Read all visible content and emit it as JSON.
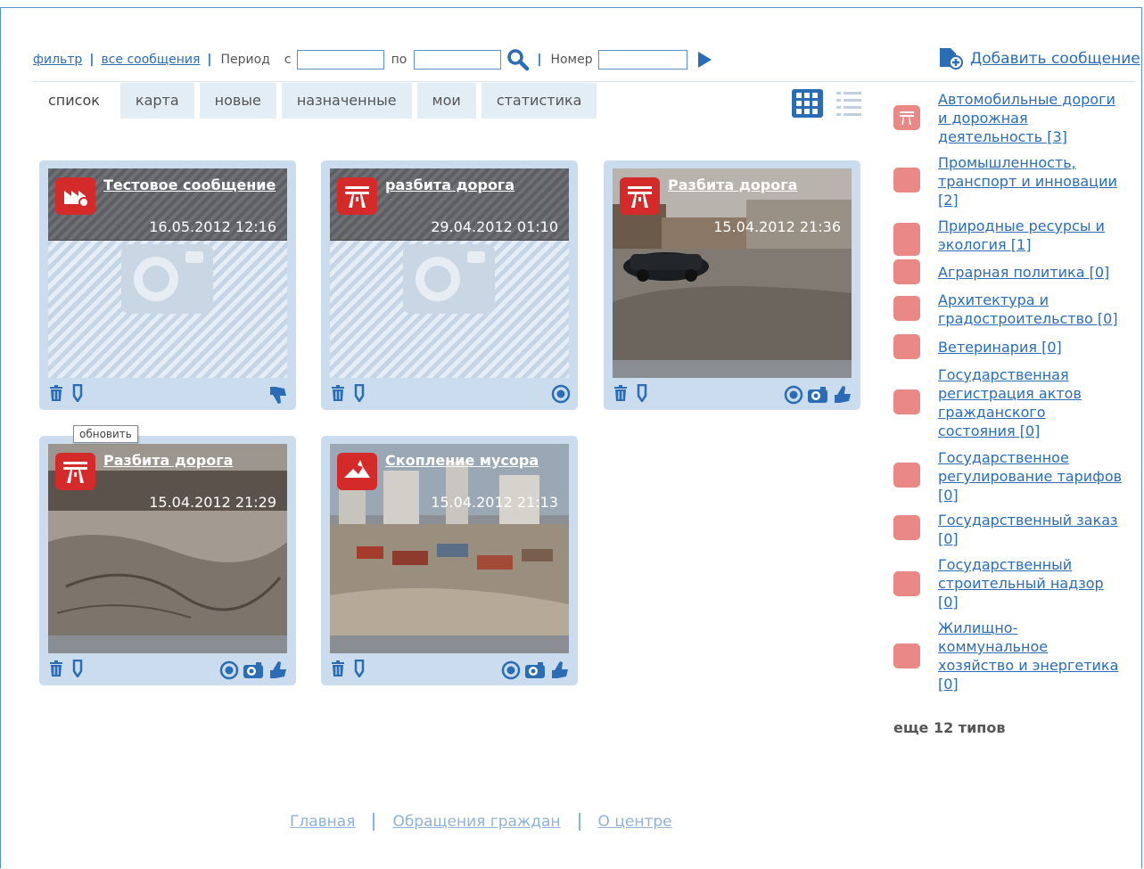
{
  "filter": {
    "filter_label": "фильтр",
    "all_messages_label": "все сообщения",
    "period_label": "Период",
    "from_label": "с",
    "to_label": "по",
    "number_label": "Номер",
    "from_value": "",
    "to_value": "",
    "number_value": ""
  },
  "add_message": {
    "label": "Добавить сообщение"
  },
  "tabs": [
    {
      "label": "список",
      "active": true
    },
    {
      "label": "карта",
      "active": false
    },
    {
      "label": "новые",
      "active": false
    },
    {
      "label": "назначенные",
      "active": false
    },
    {
      "label": "мои",
      "active": false
    },
    {
      "label": "статистика",
      "active": false
    }
  ],
  "cards": [
    {
      "title": "Тестовое сообщение",
      "date": "16.05.2012 12:16",
      "category_icon": "industry-icon",
      "has_photo": false
    },
    {
      "title": "разбита дорога",
      "date": "29.04.2012 01:10",
      "category_icon": "road-icon",
      "has_photo": false
    },
    {
      "title": "Разбита дорога",
      "date": "15.04.2012 21:36",
      "category_icon": "road-icon",
      "has_photo": true
    },
    {
      "title": "Разбита дорога",
      "date": "15.04.2012 21:29",
      "category_icon": "road-icon",
      "has_photo": true
    },
    {
      "title": "Скопление мусора",
      "date": "15.04.2012 21:13",
      "category_icon": "ecology-icon",
      "has_photo": true
    }
  ],
  "tooltip": {
    "text": "обновить"
  },
  "categories": [
    {
      "label": "Автомобильные дороги и дорожная деятельность [3]",
      "icon": "road-icon"
    },
    {
      "label": "Промышленность, транспорт и инновации [2]",
      "icon": "industry-icon"
    },
    {
      "label": "Природные ресурсы и экология [1]",
      "icon": "ecology-icon"
    },
    {
      "label": "Аграрная политика [0]",
      "icon": "agriculture-icon"
    },
    {
      "label": "Архитектура и градостроительство [0]",
      "icon": "architecture-icon"
    },
    {
      "label": "Ветеринария [0]",
      "icon": "veterinary-icon"
    },
    {
      "label": "Государственная регистрация актов гражданского состояния [0]",
      "icon": "registry-icon"
    },
    {
      "label": "Государственное регулирование тарифов [0]",
      "icon": "tariff-icon"
    },
    {
      "label": "Государственный заказ [0]",
      "icon": "order-icon"
    },
    {
      "label": "Государственный строительный надзор [0]",
      "icon": "construction-icon"
    },
    {
      "label": "Жилищно-коммунальное хозяйство и энергетика [0]",
      "icon": "housing-icon"
    }
  ],
  "more_types": "еще 12 типов",
  "footer": [
    "Главная",
    "Обращения граждан",
    "О центре"
  ],
  "colors": {
    "accent": "#2a6db5",
    "category_red": "#d42a2a",
    "card_bg": "#cadced"
  }
}
